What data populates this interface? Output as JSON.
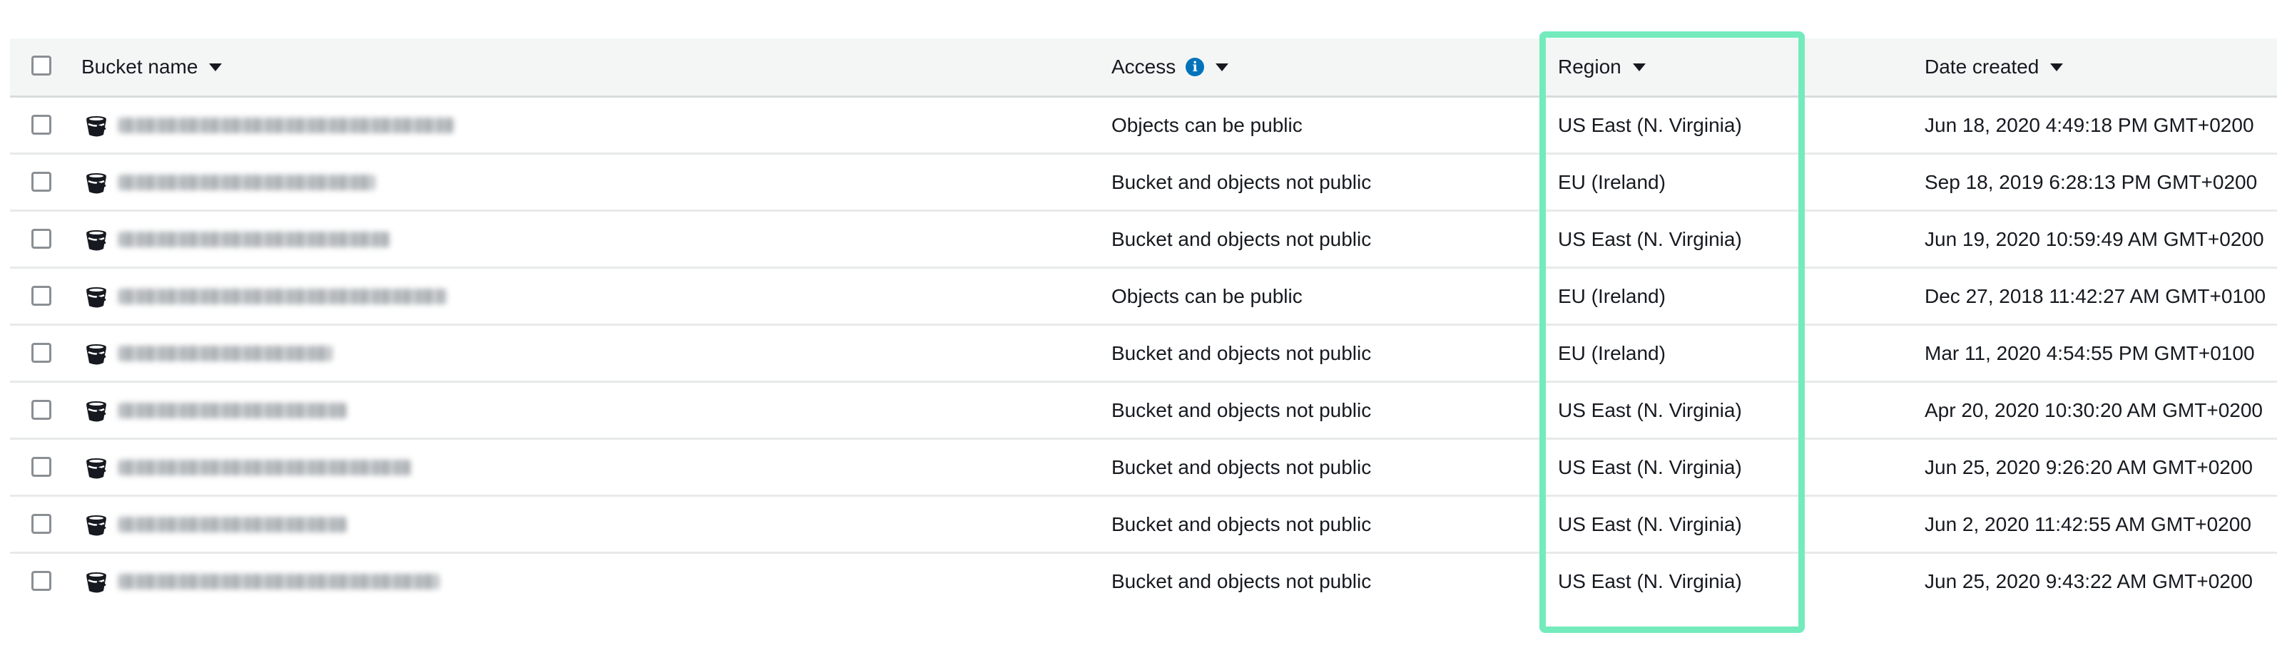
{
  "header": {
    "bucket_name": "Bucket name",
    "access": "Access",
    "region": "Region",
    "date_created": "Date created",
    "info_icon_glyph": "i"
  },
  "colors": {
    "highlight": "#73ebbd",
    "info": "#0073bb",
    "header_bg": "#f4f6f6"
  },
  "icons": {
    "bucket": "bucket-icon",
    "info": "info-icon",
    "sort": "caret-down-icon"
  },
  "rows": [
    {
      "access": "Objects can be public",
      "region": "US East (N. Virginia)",
      "date": "Jun 18, 2020 4:49:18 PM GMT+0200"
    },
    {
      "access": "Bucket and objects not public",
      "region": "EU (Ireland)",
      "date": "Sep 18, 2019 6:28:13 PM GMT+0200"
    },
    {
      "access": "Bucket and objects not public",
      "region": "US East (N. Virginia)",
      "date": "Jun 19, 2020 10:59:49 AM GMT+0200"
    },
    {
      "access": "Objects can be public",
      "region": "EU (Ireland)",
      "date": "Dec 27, 2018 11:42:27 AM GMT+0100"
    },
    {
      "access": "Bucket and objects not public",
      "region": "EU (Ireland)",
      "date": "Mar 11, 2020 4:54:55 PM GMT+0100"
    },
    {
      "access": "Bucket and objects not public",
      "region": "US East (N. Virginia)",
      "date": "Apr 20, 2020 10:30:20 AM GMT+0200"
    },
    {
      "access": "Bucket and objects not public",
      "region": "US East (N. Virginia)",
      "date": "Jun 25, 2020 9:26:20 AM GMT+0200"
    },
    {
      "access": "Bucket and objects not public",
      "region": "US East (N. Virginia)",
      "date": "Jun 2, 2020 11:42:55 AM GMT+0200"
    },
    {
      "access": "Bucket and objects not public",
      "region": "US East (N. Virginia)",
      "date": "Jun 25, 2020 9:43:22 AM GMT+0200"
    }
  ]
}
